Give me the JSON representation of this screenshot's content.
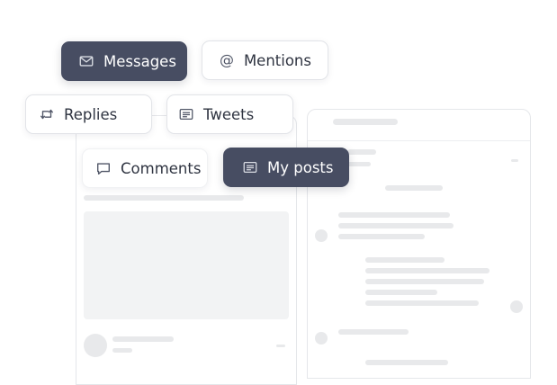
{
  "filters": {
    "messages": {
      "label": "Messages",
      "icon": "envelope-icon",
      "active": true
    },
    "mentions": {
      "label": "Mentions",
      "icon": "at-sign-icon",
      "glyph": "@",
      "active": false
    },
    "replies": {
      "label": "Replies",
      "icon": "retweet-icon",
      "active": false
    },
    "tweets": {
      "label": "Tweets",
      "icon": "document-lines-icon",
      "active": false
    },
    "comments": {
      "label": "Comments",
      "icon": "speech-bubble-icon",
      "active": false
    },
    "my_posts": {
      "label": "My posts",
      "icon": "document-lines-icon",
      "active": true
    }
  },
  "colors": {
    "active_background": "#474d62",
    "active_text": "#ffffff",
    "inactive_background": "#ffffff",
    "inactive_text": "#2f3441",
    "skeleton": "#e8e9eb",
    "border": "#e5e7ea"
  }
}
